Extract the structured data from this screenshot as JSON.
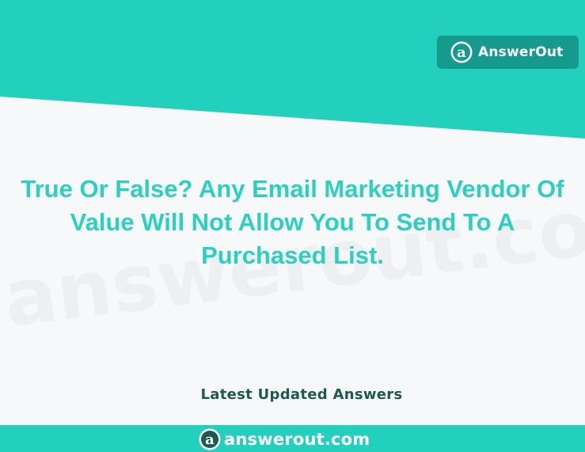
{
  "brand": {
    "name": "AnswerOut",
    "logo_icon": "answerout-a-logo-icon",
    "accent_color": "#23cfbd",
    "badge_color": "#169a8e"
  },
  "question": {
    "text": "True Or False? Any Email Marketing Vendor Of Value Will Not Allow You To Send To A Purchased List."
  },
  "section": {
    "latest_label": "Latest Updated Answers"
  },
  "watermark": {
    "text": "answerout.com"
  },
  "footer": {
    "site": "answerout.com",
    "logo_icon": "answerout-a-logo-icon"
  }
}
